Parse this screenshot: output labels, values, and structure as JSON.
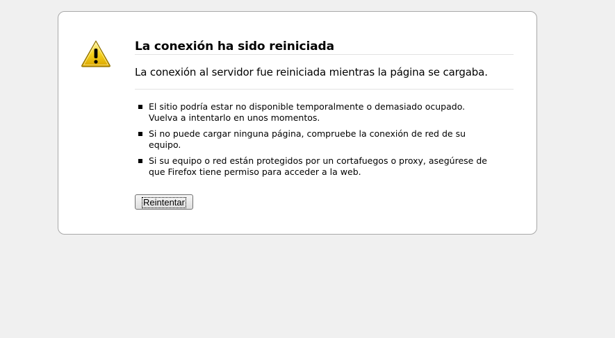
{
  "error": {
    "title": "La conexión ha sido reiniciada",
    "short_description": "La conexión al servidor fue reiniciada mientras la página se cargaba.",
    "items": [
      "El sitio podría estar no disponible temporalmente o demasiado ocupado. Vuelva a intentarlo en unos momentos.",
      "Si no puede cargar ninguna página, compruebe la conexión de red de su equipo.",
      "Si su equipo o red están protegidos por un cortafuegos o proxy, asegúrese de que Firefox tiene permiso para acceder a la web."
    ],
    "retry_label": "Reintentar",
    "icon": "warning-icon"
  },
  "colors": {
    "background": "#f0f0f0",
    "box": "#ffffff",
    "border": "#a8a8a8",
    "warning_yellow": "#f5c400"
  }
}
